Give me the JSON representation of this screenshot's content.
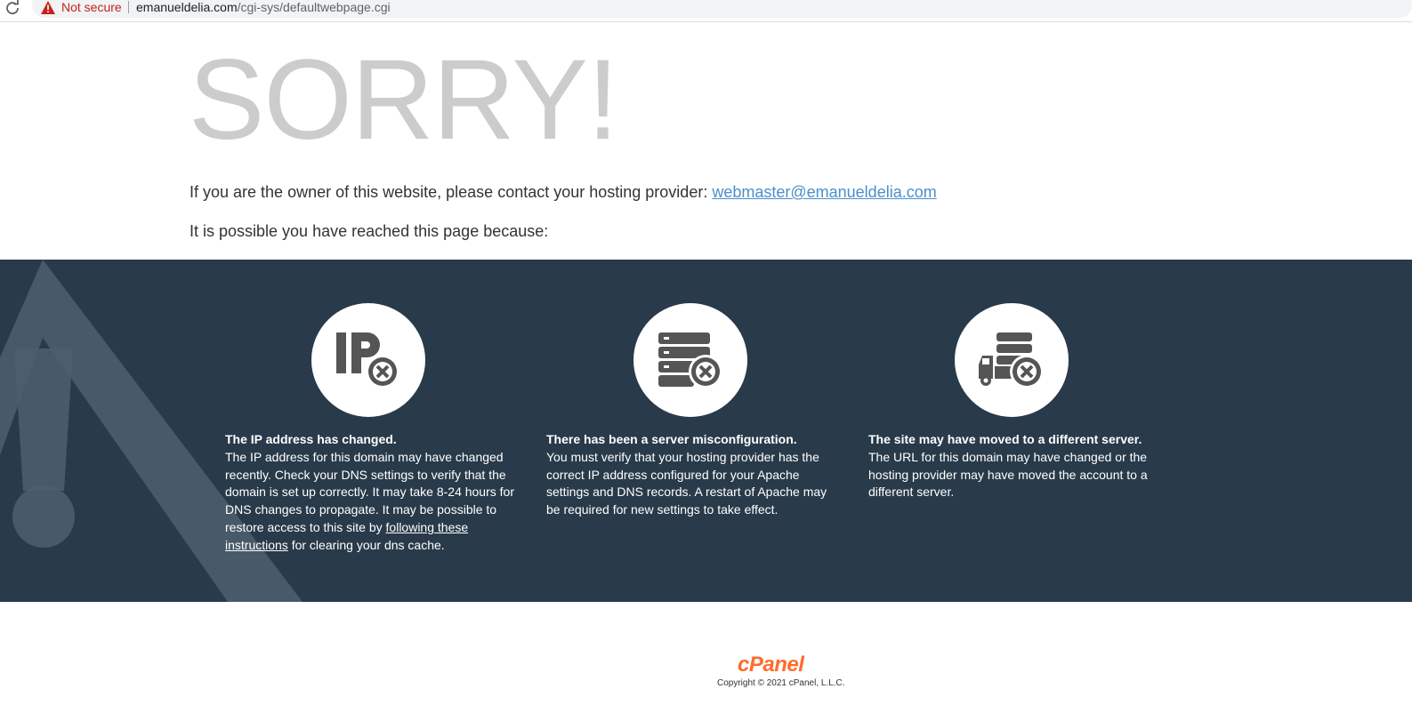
{
  "browser": {
    "reload_icon": "reload-icon",
    "security_icon": "warning-triangle-icon",
    "security_label": "Not secure",
    "url_host": "emanueldelia.com",
    "url_path": "/cgi-sys/defaultwebpage.cgi"
  },
  "page": {
    "heading": "SORRY!",
    "contact_text": "If you are the owner of this website, please contact your hosting provider: ",
    "contact_email": "webmaster@emanueldelia.com",
    "reasons_intro": "It is possible you have reached this page because:"
  },
  "reasons": [
    {
      "icon": "ip-error-icon",
      "title": "The IP address has changed.",
      "body_before_link": "The IP address for this domain may have changed recently. Check your DNS settings to verify that the domain is set up correctly. It may take 8-24 hours for DNS changes to propagate. It may be possible to restore access to this site by ",
      "link_text": "following these instructions",
      "body_after_link": " for clearing your dns cache."
    },
    {
      "icon": "server-error-icon",
      "title": "There has been a server misconfiguration.",
      "body": "You must verify that your hosting provider has the correct IP address configured for your Apache settings and DNS records. A restart of Apache may be required for new settings to take effect."
    },
    {
      "icon": "server-moved-icon",
      "title": "The site may have moved to a different server.",
      "body": "The URL for this domain may have changed or the hosting provider may have moved the account to a different server."
    }
  ],
  "footer": {
    "logo": "cPanel",
    "copyright": "Copyright © 2021 cPanel, L.L.C."
  },
  "colors": {
    "dark_bg": "#293a4a",
    "sorry_gray": "#cccccc",
    "link_blue": "#4a8fcc",
    "cpanel_orange": "#ff6c2c",
    "icon_gray": "#555555"
  }
}
